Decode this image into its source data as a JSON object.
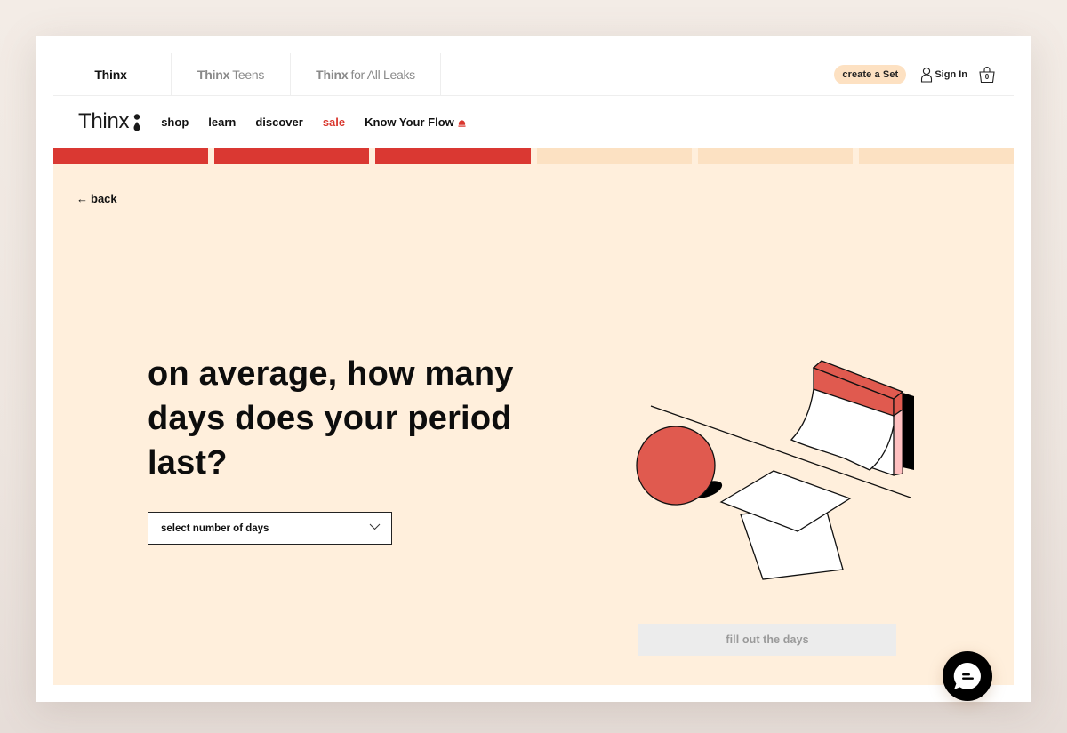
{
  "brand_tabs": [
    {
      "bold": "Thinx",
      "light": "",
      "active": true
    },
    {
      "bold": "Thinx",
      "light": "Teens",
      "active": false
    },
    {
      "bold": "Thinx",
      "light": "for All Leaks",
      "active": false
    }
  ],
  "header_tools": {
    "create_set_label": "create a Set",
    "sign_in_label": "Sign In",
    "cart_count": "0",
    "icons": {
      "user": "user-icon",
      "cart": "shopping-bag-icon"
    }
  },
  "main_nav": {
    "logo_text": "Thinx",
    "logo_icon": "drop-colon-icon",
    "links": [
      {
        "label": "shop"
      },
      {
        "label": "learn"
      },
      {
        "label": "discover"
      },
      {
        "label": "sale",
        "highlight": true
      },
      {
        "label": "Know Your Flow",
        "icon": "red-drop-icon"
      }
    ]
  },
  "quiz": {
    "progress": {
      "completed_steps": 3,
      "total_steps": 6
    },
    "back_label": "back",
    "back_icon": "arrow-left-icon",
    "question": "on average, how many days does your period last?",
    "select": {
      "placeholder": "select number of days",
      "icon": "chevron-down-icon"
    },
    "submit_label": "fill out the days",
    "submit_disabled": true,
    "illustration": "calendar-ball-papers-illustration"
  },
  "chat": {
    "icon": "chat-bubble-icon"
  },
  "colors": {
    "accent_red": "#da3832",
    "quiz_bg": "#ffefdc",
    "progress_pending": "#fce1c2",
    "create_set_bg": "#fde1c2",
    "disabled_btn_bg": "#ececec"
  }
}
